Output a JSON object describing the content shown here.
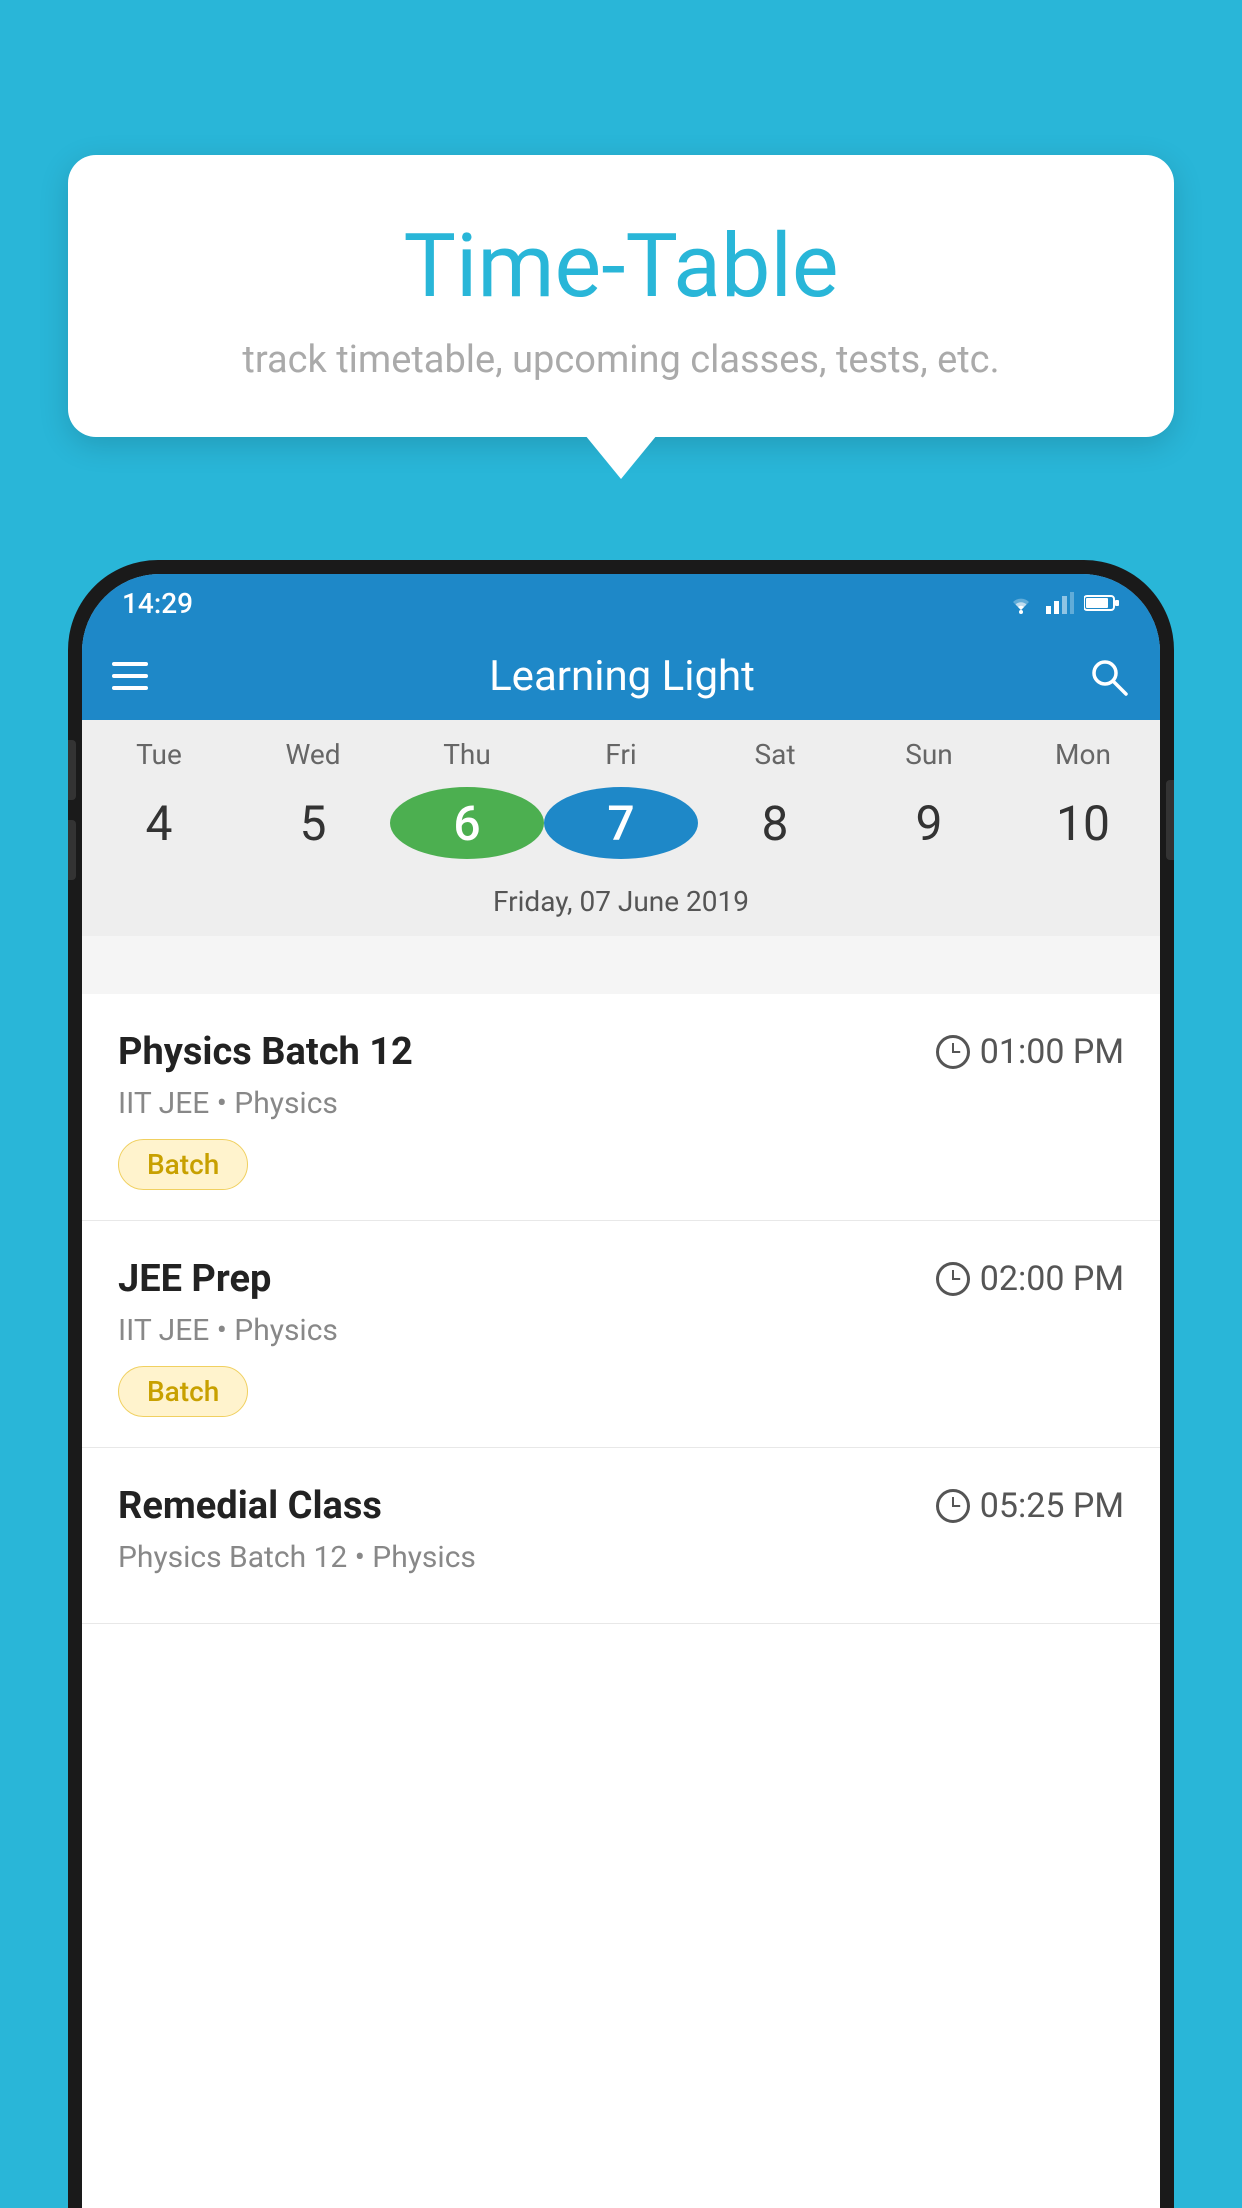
{
  "background_color": "#29b6d8",
  "speech_bubble": {
    "title": "Time-Table",
    "subtitle": "track timetable, upcoming classes, tests, etc."
  },
  "app": {
    "name": "Learning Light",
    "status_bar": {
      "time": "14:29"
    }
  },
  "calendar": {
    "selected_date_label": "Friday, 07 June 2019",
    "days": [
      {
        "label": "Tue",
        "number": "4",
        "state": "normal"
      },
      {
        "label": "Wed",
        "number": "5",
        "state": "normal"
      },
      {
        "label": "Thu",
        "number": "6",
        "state": "today"
      },
      {
        "label": "Fri",
        "number": "7",
        "state": "selected"
      },
      {
        "label": "Sat",
        "number": "8",
        "state": "normal"
      },
      {
        "label": "Sun",
        "number": "9",
        "state": "normal"
      },
      {
        "label": "Mon",
        "number": "10",
        "state": "normal"
      }
    ]
  },
  "schedule_items": [
    {
      "title": "Physics Batch 12",
      "time": "01:00 PM",
      "subtitle": "IIT JEE • Physics",
      "badge": "Batch"
    },
    {
      "title": "JEE Prep",
      "time": "02:00 PM",
      "subtitle": "IIT JEE • Physics",
      "badge": "Batch"
    },
    {
      "title": "Remedial Class",
      "time": "05:25 PM",
      "subtitle": "Physics Batch 12 • Physics",
      "badge": null
    }
  ]
}
